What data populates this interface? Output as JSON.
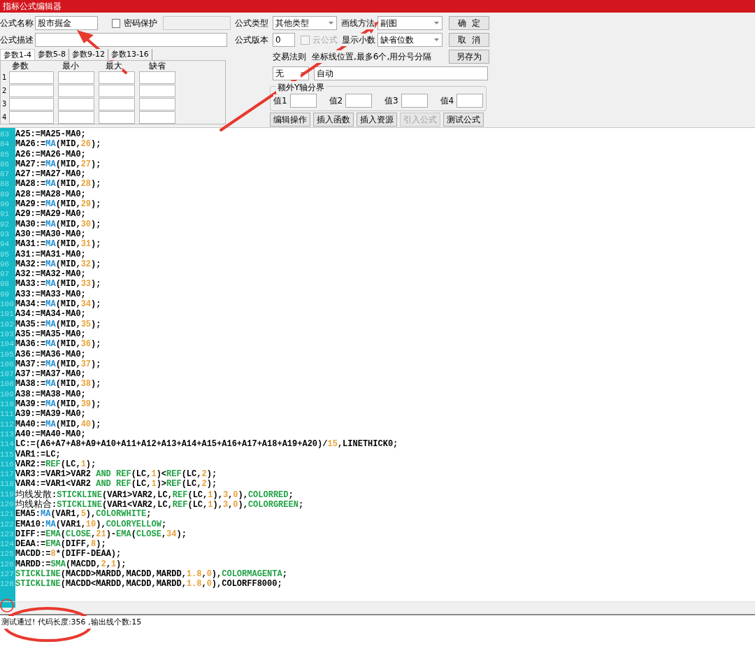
{
  "window": {
    "title": "指标公式编辑器"
  },
  "form": {
    "name": {
      "label": "公式名称",
      "value": "股市掘金"
    },
    "password": {
      "label": "密码保护",
      "checked": false
    },
    "description": {
      "label": "公式描述"
    },
    "param_tabs": [
      {
        "label": "参数1-4",
        "selected": true
      },
      {
        "label": "参数5-8",
        "selected": false
      },
      {
        "label": "参数9-12",
        "selected": false
      },
      {
        "label": "参数13-16",
        "selected": false
      }
    ],
    "param_headers": [
      "参数",
      "最小",
      "最大",
      "缺省"
    ],
    "param_rows": [
      "1",
      "2",
      "3",
      "4"
    ],
    "type": {
      "label": "公式类型",
      "value": "其他类型"
    },
    "draw_method": {
      "label": "画线方法",
      "value": "副图"
    },
    "version": {
      "label": "公式版本",
      "value": "0"
    },
    "cloud": {
      "label": "云公式",
      "checked": false,
      "disabled": true
    },
    "decimals": {
      "label": "显示小数",
      "value": "缺省位数"
    },
    "trade_rule": {
      "label": "交易法则",
      "value": "无"
    },
    "axis": {
      "label": "坐标线位置,最多6个,用分号分隔",
      "value": "自动"
    },
    "y_bounds": {
      "legend": "额外Y轴分界",
      "fields": [
        "值1",
        "值2",
        "值3",
        "值4"
      ]
    },
    "side_buttons": [
      "确  定",
      "取  消",
      "另存为"
    ],
    "action_buttons": [
      {
        "label": "编辑操作",
        "disabled": false
      },
      {
        "label": "插入函数",
        "disabled": false
      },
      {
        "label": "插入资源",
        "disabled": false
      },
      {
        "label": "引入公式",
        "disabled": true
      },
      {
        "label": "测试公式",
        "disabled": false
      }
    ]
  },
  "editor": {
    "lines": [
      {
        "number": "83",
        "tokens": [
          {
            "kind": "plain",
            "text": "A25:=MA25-MA0;"
          }
        ]
      },
      {
        "number": "84",
        "tokens": [
          {
            "kind": "plain",
            "text": "MA26:="
          },
          {
            "kind": "fn",
            "text": "MA"
          },
          {
            "kind": "plain",
            "text": "(MID,"
          },
          {
            "kind": "num",
            "text": "26"
          },
          {
            "kind": "plain",
            "text": ");"
          }
        ]
      },
      {
        "number": "85",
        "tokens": [
          {
            "kind": "plain",
            "text": "A26:=MA26-MA0;"
          }
        ]
      },
      {
        "number": "86",
        "tokens": [
          {
            "kind": "plain",
            "text": "MA27:="
          },
          {
            "kind": "fn",
            "text": "MA"
          },
          {
            "kind": "plain",
            "text": "(MID,"
          },
          {
            "kind": "num",
            "text": "27"
          },
          {
            "kind": "plain",
            "text": ");"
          }
        ]
      },
      {
        "number": "87",
        "tokens": [
          {
            "kind": "plain",
            "text": "A27:=MA27-MA0;"
          }
        ]
      },
      {
        "number": "88",
        "tokens": [
          {
            "kind": "plain",
            "text": "MA28:="
          },
          {
            "kind": "fn",
            "text": "MA"
          },
          {
            "kind": "plain",
            "text": "(MID,"
          },
          {
            "kind": "num",
            "text": "28"
          },
          {
            "kind": "plain",
            "text": ");"
          }
        ]
      },
      {
        "number": "89",
        "tokens": [
          {
            "kind": "plain",
            "text": "A28:=MA28-MA0;"
          }
        ]
      },
      {
        "number": "90",
        "tokens": [
          {
            "kind": "plain",
            "text": "MA29:="
          },
          {
            "kind": "fn",
            "text": "MA"
          },
          {
            "kind": "plain",
            "text": "(MID,"
          },
          {
            "kind": "num",
            "text": "29"
          },
          {
            "kind": "plain",
            "text": ");"
          }
        ]
      },
      {
        "number": "91",
        "tokens": [
          {
            "kind": "plain",
            "text": "A29:=MA29-MA0;"
          }
        ]
      },
      {
        "number": "92",
        "tokens": [
          {
            "kind": "plain",
            "text": "MA30:="
          },
          {
            "kind": "fn",
            "text": "MA"
          },
          {
            "kind": "plain",
            "text": "(MID,"
          },
          {
            "kind": "num",
            "text": "30"
          },
          {
            "kind": "plain",
            "text": ");"
          }
        ]
      },
      {
        "number": "93",
        "tokens": [
          {
            "kind": "plain",
            "text": "A30:=MA30-MA0;"
          }
        ]
      },
      {
        "number": "94",
        "tokens": [
          {
            "kind": "plain",
            "text": "MA31:="
          },
          {
            "kind": "fn",
            "text": "MA"
          },
          {
            "kind": "plain",
            "text": "(MID,"
          },
          {
            "kind": "num",
            "text": "31"
          },
          {
            "kind": "plain",
            "text": ");"
          }
        ]
      },
      {
        "number": "95",
        "tokens": [
          {
            "kind": "plain",
            "text": "A31:=MA31-MA0;"
          }
        ]
      },
      {
        "number": "96",
        "tokens": [
          {
            "kind": "plain",
            "text": "MA32:="
          },
          {
            "kind": "fn",
            "text": "MA"
          },
          {
            "kind": "plain",
            "text": "(MID,"
          },
          {
            "kind": "num",
            "text": "32"
          },
          {
            "kind": "plain",
            "text": ");"
          }
        ]
      },
      {
        "number": "97",
        "tokens": [
          {
            "kind": "plain",
            "text": "A32:=MA32-MA0;"
          }
        ]
      },
      {
        "number": "98",
        "tokens": [
          {
            "kind": "plain",
            "text": "MA33:="
          },
          {
            "kind": "fn",
            "text": "MA"
          },
          {
            "kind": "plain",
            "text": "(MID,"
          },
          {
            "kind": "num",
            "text": "33"
          },
          {
            "kind": "plain",
            "text": ");"
          }
        ]
      },
      {
        "number": "99",
        "tokens": [
          {
            "kind": "plain",
            "text": "A33:=MA33-MA0;"
          }
        ]
      },
      {
        "number": "100",
        "tokens": [
          {
            "kind": "plain",
            "text": "MA34:="
          },
          {
            "kind": "fn",
            "text": "MA"
          },
          {
            "kind": "plain",
            "text": "(MID,"
          },
          {
            "kind": "num",
            "text": "34"
          },
          {
            "kind": "plain",
            "text": ");"
          }
        ]
      },
      {
        "number": "101",
        "tokens": [
          {
            "kind": "plain",
            "text": "A34:=MA34-MA0;"
          }
        ]
      },
      {
        "number": "102",
        "tokens": [
          {
            "kind": "plain",
            "text": "MA35:="
          },
          {
            "kind": "fn",
            "text": "MA"
          },
          {
            "kind": "plain",
            "text": "(MID,"
          },
          {
            "kind": "num",
            "text": "35"
          },
          {
            "kind": "plain",
            "text": ");"
          }
        ]
      },
      {
        "number": "103",
        "tokens": [
          {
            "kind": "plain",
            "text": "A35:=MA35-MA0;"
          }
        ]
      },
      {
        "number": "104",
        "tokens": [
          {
            "kind": "plain",
            "text": "MA36:="
          },
          {
            "kind": "fn",
            "text": "MA"
          },
          {
            "kind": "plain",
            "text": "(MID,"
          },
          {
            "kind": "num",
            "text": "36"
          },
          {
            "kind": "plain",
            "text": ");"
          }
        ]
      },
      {
        "number": "105",
        "tokens": [
          {
            "kind": "plain",
            "text": "A36:=MA36-MA0;"
          }
        ]
      },
      {
        "number": "106",
        "tokens": [
          {
            "kind": "plain",
            "text": "MA37:="
          },
          {
            "kind": "fn",
            "text": "MA"
          },
          {
            "kind": "plain",
            "text": "(MID,"
          },
          {
            "kind": "num",
            "text": "37"
          },
          {
            "kind": "plain",
            "text": ");"
          }
        ]
      },
      {
        "number": "107",
        "tokens": [
          {
            "kind": "plain",
            "text": "A37:=MA37-MA0;"
          }
        ]
      },
      {
        "number": "108",
        "tokens": [
          {
            "kind": "plain",
            "text": "MA38:="
          },
          {
            "kind": "fn",
            "text": "MA"
          },
          {
            "kind": "plain",
            "text": "(MID,"
          },
          {
            "kind": "num",
            "text": "38"
          },
          {
            "kind": "plain",
            "text": ");"
          }
        ]
      },
      {
        "number": "109",
        "tokens": [
          {
            "kind": "plain",
            "text": "A38:=MA38-MA0;"
          }
        ]
      },
      {
        "number": "110",
        "tokens": [
          {
            "kind": "plain",
            "text": "MA39:="
          },
          {
            "kind": "fn",
            "text": "MA"
          },
          {
            "kind": "plain",
            "text": "(MID,"
          },
          {
            "kind": "num",
            "text": "39"
          },
          {
            "kind": "plain",
            "text": ");"
          }
        ]
      },
      {
        "number": "111",
        "tokens": [
          {
            "kind": "plain",
            "text": "A39:=MA39-MA0;"
          }
        ]
      },
      {
        "number": "112",
        "tokens": [
          {
            "kind": "plain",
            "text": "MA40:="
          },
          {
            "kind": "fn",
            "text": "MA"
          },
          {
            "kind": "plain",
            "text": "(MID,"
          },
          {
            "kind": "num",
            "text": "40"
          },
          {
            "kind": "plain",
            "text": ");"
          }
        ]
      },
      {
        "number": "113",
        "tokens": [
          {
            "kind": "plain",
            "text": "A40:=MA40-MA0;"
          }
        ]
      },
      {
        "number": "114",
        "tokens": [
          {
            "kind": "plain",
            "text": "LC:=(A6+A7+A8+A9+A10+A11+A12+A13+A14+A15+A16+A17+A18+A19+A20)/"
          },
          {
            "kind": "num",
            "text": "15"
          },
          {
            "kind": "plain",
            "text": ",LINETHICK0;"
          }
        ]
      },
      {
        "number": "115",
        "tokens": [
          {
            "kind": "plain",
            "text": "VAR1:=LC;"
          }
        ]
      },
      {
        "number": "116",
        "tokens": [
          {
            "kind": "plain",
            "text": "VAR2:="
          },
          {
            "kind": "kw",
            "text": "REF"
          },
          {
            "kind": "plain",
            "text": "(LC,"
          },
          {
            "kind": "num",
            "text": "1"
          },
          {
            "kind": "plain",
            "text": ");"
          }
        ]
      },
      {
        "number": "117",
        "tokens": [
          {
            "kind": "plain",
            "text": "VAR3:=VAR1>VAR2 "
          },
          {
            "kind": "kw",
            "text": "AND REF"
          },
          {
            "kind": "plain",
            "text": "(LC,"
          },
          {
            "kind": "num",
            "text": "1"
          },
          {
            "kind": "plain",
            "text": ")<"
          },
          {
            "kind": "kw",
            "text": "REF"
          },
          {
            "kind": "plain",
            "text": "(LC,"
          },
          {
            "kind": "num",
            "text": "2"
          },
          {
            "kind": "plain",
            "text": ");"
          }
        ]
      },
      {
        "number": "118",
        "tokens": [
          {
            "kind": "plain",
            "text": "VAR4:=VAR1<VAR2 "
          },
          {
            "kind": "kw",
            "text": "AND REF"
          },
          {
            "kind": "plain",
            "text": "(LC,"
          },
          {
            "kind": "num",
            "text": "1"
          },
          {
            "kind": "plain",
            "text": ")>"
          },
          {
            "kind": "kw",
            "text": "REF"
          },
          {
            "kind": "plain",
            "text": "(LC,"
          },
          {
            "kind": "num",
            "text": "2"
          },
          {
            "kind": "plain",
            "text": ");"
          }
        ]
      },
      {
        "number": "119",
        "tokens": [
          {
            "kind": "cjk",
            "text": "均线发散"
          },
          {
            "kind": "plain",
            "text": ":"
          },
          {
            "kind": "kw",
            "text": "STICKLINE"
          },
          {
            "kind": "plain",
            "text": "(VAR1>VAR2,LC,"
          },
          {
            "kind": "kw",
            "text": "REF"
          },
          {
            "kind": "plain",
            "text": "(LC,"
          },
          {
            "kind": "num",
            "text": "1"
          },
          {
            "kind": "plain",
            "text": "),"
          },
          {
            "kind": "num",
            "text": "3"
          },
          {
            "kind": "plain",
            "text": ","
          },
          {
            "kind": "num",
            "text": "0"
          },
          {
            "kind": "plain",
            "text": "),"
          },
          {
            "kind": "kw",
            "text": "COLORRED"
          },
          {
            "kind": "plain",
            "text": ";"
          }
        ]
      },
      {
        "number": "120",
        "tokens": [
          {
            "kind": "cjk",
            "text": "均线粘合"
          },
          {
            "kind": "plain",
            "text": ":"
          },
          {
            "kind": "kw",
            "text": "STICKLINE"
          },
          {
            "kind": "plain",
            "text": "(VAR1<VAR2,LC,"
          },
          {
            "kind": "kw",
            "text": "REF"
          },
          {
            "kind": "plain",
            "text": "(LC,"
          },
          {
            "kind": "num",
            "text": "1"
          },
          {
            "kind": "plain",
            "text": "),"
          },
          {
            "kind": "num",
            "text": "3"
          },
          {
            "kind": "plain",
            "text": ","
          },
          {
            "kind": "num",
            "text": "0"
          },
          {
            "kind": "plain",
            "text": "),"
          },
          {
            "kind": "kw",
            "text": "COLORGREEN"
          },
          {
            "kind": "plain",
            "text": ";"
          }
        ]
      },
      {
        "number": "121",
        "tokens": [
          {
            "kind": "plain",
            "text": "EMA5:"
          },
          {
            "kind": "fn",
            "text": "MA"
          },
          {
            "kind": "plain",
            "text": "(VAR1,"
          },
          {
            "kind": "num",
            "text": "5"
          },
          {
            "kind": "plain",
            "text": "),"
          },
          {
            "kind": "kw",
            "text": "COLORWHITE"
          },
          {
            "kind": "plain",
            "text": ";"
          }
        ]
      },
      {
        "number": "122",
        "tokens": [
          {
            "kind": "plain",
            "text": "EMA10:"
          },
          {
            "kind": "fn",
            "text": "MA"
          },
          {
            "kind": "plain",
            "text": "(VAR1,"
          },
          {
            "kind": "num",
            "text": "10"
          },
          {
            "kind": "plain",
            "text": "),"
          },
          {
            "kind": "kw",
            "text": "COLORYELLOW"
          },
          {
            "kind": "plain",
            "text": ";"
          }
        ]
      },
      {
        "number": "123",
        "tokens": [
          {
            "kind": "plain",
            "text": "DIFF:="
          },
          {
            "kind": "kw",
            "text": "EMA"
          },
          {
            "kind": "plain",
            "text": "("
          },
          {
            "kind": "kw",
            "text": "CLOSE"
          },
          {
            "kind": "plain",
            "text": ","
          },
          {
            "kind": "num",
            "text": "21"
          },
          {
            "kind": "plain",
            "text": ")-"
          },
          {
            "kind": "kw",
            "text": "EMA"
          },
          {
            "kind": "plain",
            "text": "("
          },
          {
            "kind": "kw",
            "text": "CLOSE"
          },
          {
            "kind": "plain",
            "text": ","
          },
          {
            "kind": "num",
            "text": "34"
          },
          {
            "kind": "plain",
            "text": ");"
          }
        ]
      },
      {
        "number": "124",
        "tokens": [
          {
            "kind": "plain",
            "text": "DEAA:="
          },
          {
            "kind": "kw",
            "text": "EMA"
          },
          {
            "kind": "plain",
            "text": "(DIFF,"
          },
          {
            "kind": "num",
            "text": "8"
          },
          {
            "kind": "plain",
            "text": ");"
          }
        ]
      },
      {
        "number": "125",
        "tokens": [
          {
            "kind": "plain",
            "text": "MACDD:="
          },
          {
            "kind": "num",
            "text": "8"
          },
          {
            "kind": "plain",
            "text": "*(DIFF-DEAA);"
          }
        ]
      },
      {
        "number": "126",
        "tokens": [
          {
            "kind": "plain",
            "text": "MARDD:="
          },
          {
            "kind": "kw",
            "text": "SMA"
          },
          {
            "kind": "plain",
            "text": "(MACDD,"
          },
          {
            "kind": "num",
            "text": "2"
          },
          {
            "kind": "plain",
            "text": ","
          },
          {
            "kind": "num",
            "text": "1"
          },
          {
            "kind": "plain",
            "text": ");"
          }
        ]
      },
      {
        "number": "127",
        "tokens": [
          {
            "kind": "kw",
            "text": "STICKLINE"
          },
          {
            "kind": "plain",
            "text": "(MACDD>MARDD,MACDD,MARDD,"
          },
          {
            "kind": "num",
            "text": "1.8"
          },
          {
            "kind": "plain",
            "text": ","
          },
          {
            "kind": "num",
            "text": "0"
          },
          {
            "kind": "plain",
            "text": "),"
          },
          {
            "kind": "kw",
            "text": "COLORMAGENTA"
          },
          {
            "kind": "plain",
            "text": ";"
          }
        ]
      },
      {
        "number": "128",
        "tokens": [
          {
            "kind": "kw",
            "text": "STICKLINE"
          },
          {
            "kind": "plain",
            "text": "(MACDD<MARDD,MACDD,MARDD,"
          },
          {
            "kind": "num",
            "text": "1.8"
          },
          {
            "kind": "plain",
            "text": ","
          },
          {
            "kind": "num",
            "text": "0"
          },
          {
            "kind": "plain",
            "text": "),COLORFF8000;"
          }
        ]
      }
    ]
  },
  "status_bar": "测试通过! 代码长度:356 ,输出线个数:15"
}
